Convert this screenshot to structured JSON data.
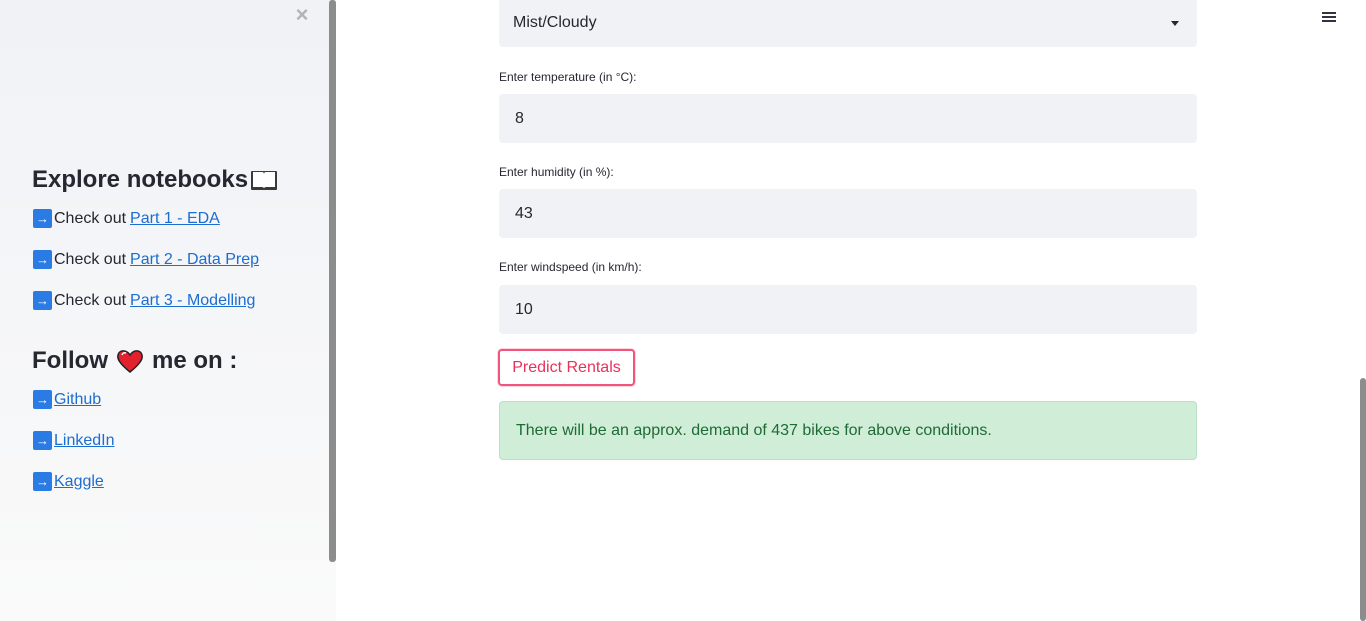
{
  "sidebar": {
    "close_label": "×",
    "explore_heading": "Explore notebooks",
    "notebooks": [
      {
        "prefix": "Check out",
        "link": "Part 1 - EDA"
      },
      {
        "prefix": "Check out",
        "link": "Part 2 - Data Prep"
      },
      {
        "prefix": "Check out",
        "link": "Part 3 - Modelling"
      }
    ],
    "follow_heading_pre": "Follow",
    "follow_heading_post": "me on :",
    "socials": [
      {
        "link": "Github"
      },
      {
        "link": "LinkedIn"
      },
      {
        "link": "Kaggle"
      }
    ],
    "arrow_glyph": "→",
    "icons": {
      "book": "open-book-icon",
      "heart": "heart-icon",
      "arrow": "right-arrow-icon"
    }
  },
  "main": {
    "weather_select": {
      "value": "Mist/Cloudy"
    },
    "temperature": {
      "label": "Enter temperature (in °C):",
      "value": "8"
    },
    "humidity": {
      "label": "Enter humidity (in %):",
      "value": "43"
    },
    "windspeed": {
      "label": "Enter windspeed (in km/h):",
      "value": "10"
    },
    "predict_button": "Predict Rentals",
    "result_message": "There will be an approx. demand of 437 bikes for above conditions."
  },
  "colors": {
    "accent": "#f0567c",
    "link": "#1c6dd0",
    "success_bg": "#d0edd8",
    "success_text": "#1e6b34"
  }
}
